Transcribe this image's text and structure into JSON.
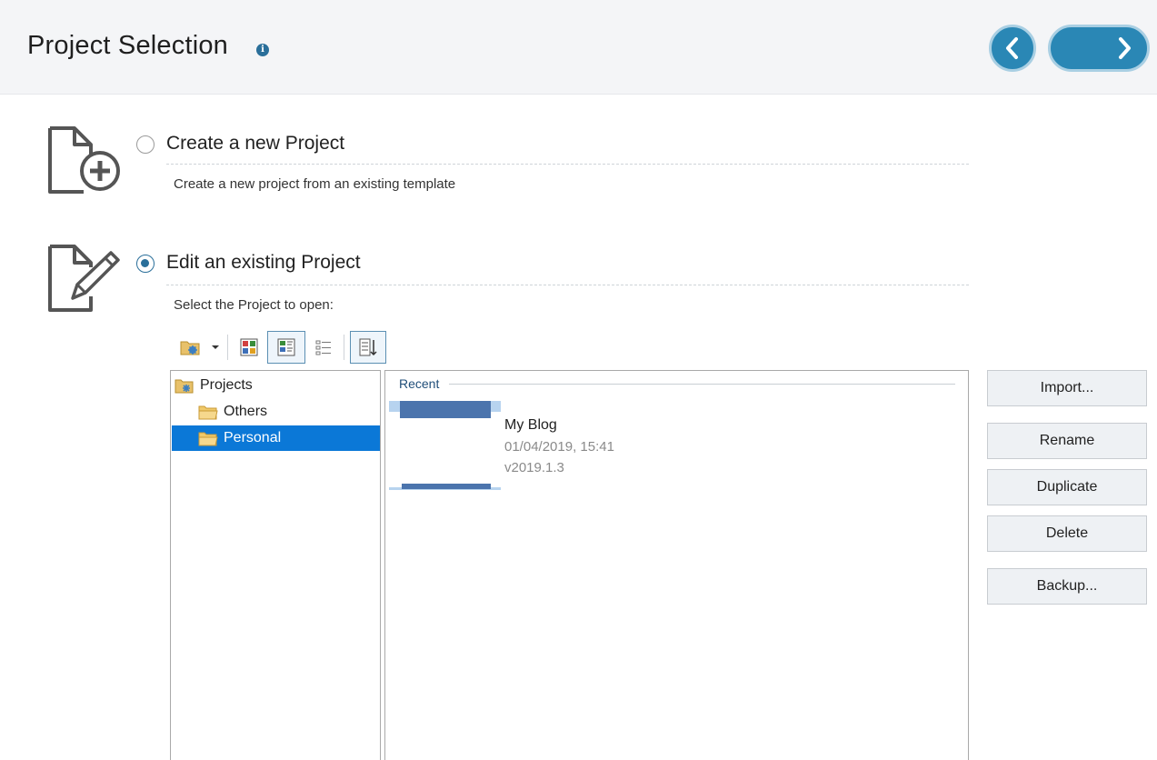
{
  "header": {
    "title": "Project Selection",
    "info_icon": "info-icon",
    "back_icon": "chevron-left-icon",
    "next_icon": "chevron-right-icon",
    "accent_color": "#2a87b5"
  },
  "options": {
    "create": {
      "label": "Create a new Project",
      "description": "Create a new project from an existing template",
      "selected": false,
      "icon": "new-document-icon"
    },
    "edit": {
      "label": "Edit an existing Project",
      "description": "Select the Project to open:",
      "selected": true,
      "icon": "edit-document-icon"
    }
  },
  "toolbar": {
    "items": [
      "project-folder-icon",
      "dropdown-arrow-icon",
      "large-icons-view-icon",
      "details-view-icon",
      "list-view-icon",
      "sort-icon"
    ]
  },
  "tree": {
    "items": [
      {
        "label": "Projects",
        "icon": "projects-folder-icon",
        "level": 0,
        "selected": false
      },
      {
        "label": "Others",
        "icon": "folder-icon",
        "level": 1,
        "selected": false
      },
      {
        "label": "Personal",
        "icon": "folder-icon",
        "level": 1,
        "selected": true
      }
    ],
    "selection_color": "#0b78d7"
  },
  "recent": {
    "header": "Recent",
    "project": {
      "name": "My Blog",
      "date": "01/04/2019, 15:41",
      "version": "v2019.1.3"
    }
  },
  "actions": {
    "import": "Import...",
    "rename": "Rename",
    "duplicate": "Duplicate",
    "delete": "Delete",
    "backup": "Backup..."
  }
}
